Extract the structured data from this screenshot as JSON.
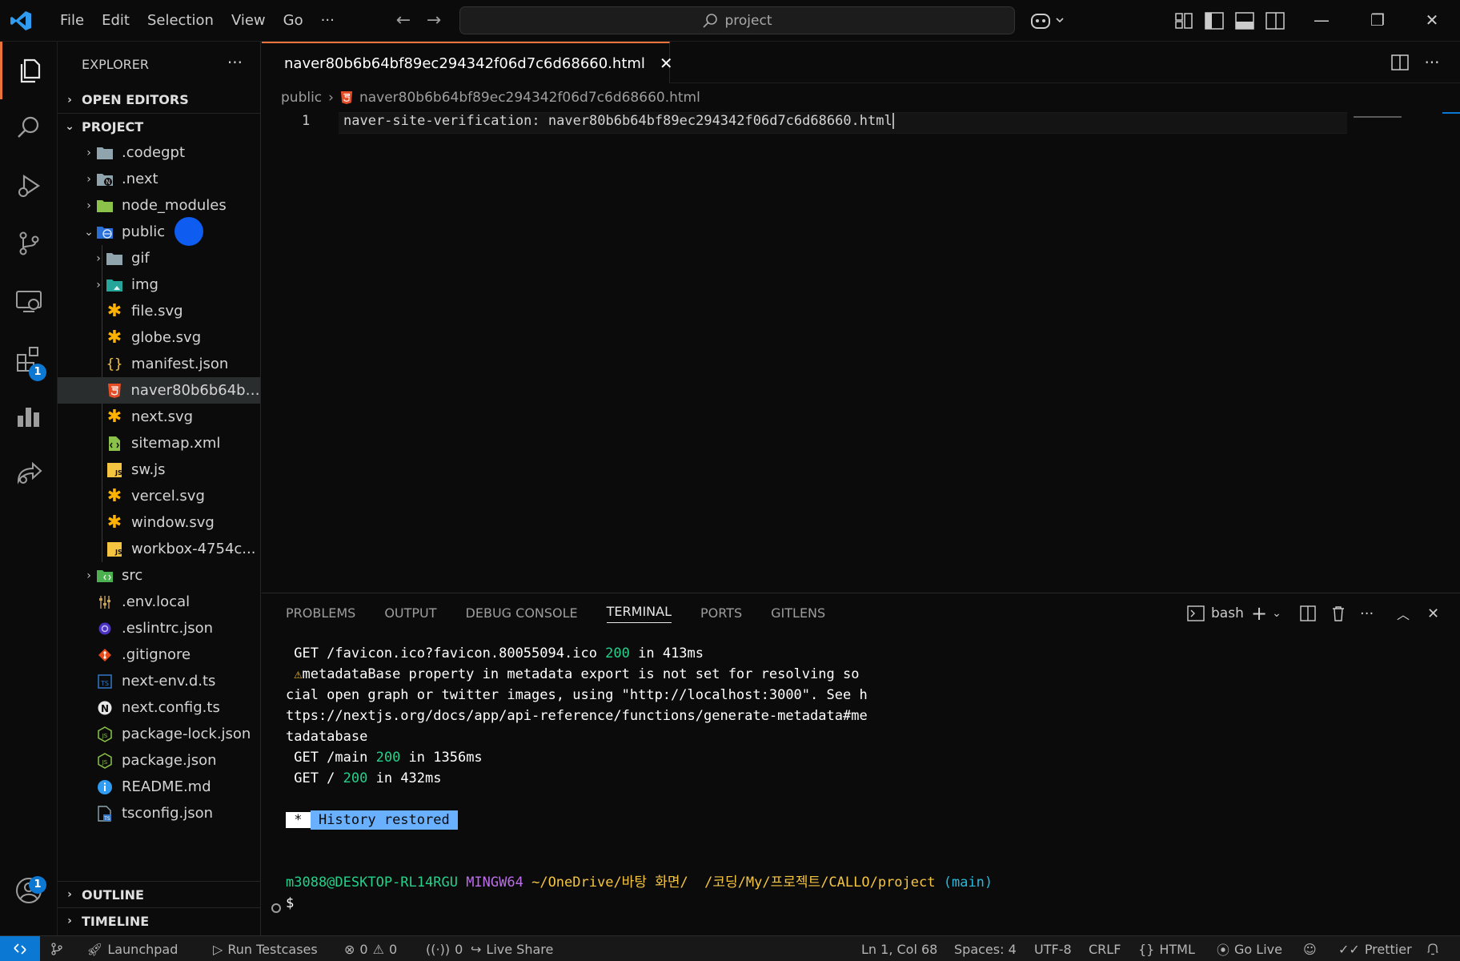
{
  "menu": [
    "File",
    "Edit",
    "Selection",
    "View",
    "Go",
    "···"
  ],
  "search": {
    "text": "project"
  },
  "window_controls": {
    "minimize": "—",
    "restore": "❐",
    "close": "✕"
  },
  "activity": {
    "extensions_badge": "1",
    "accounts_badge": "1"
  },
  "explorer": {
    "title": "EXPLORER",
    "more": "···",
    "open_editors": "OPEN EDITORS",
    "project": "PROJECT",
    "outline": "OUTLINE",
    "timeline": "TIMELINE",
    "tree": [
      {
        "label": ".codegpt",
        "chev": "›"
      },
      {
        "label": ".next",
        "chev": "›"
      },
      {
        "label": "node_modules",
        "chev": "›"
      },
      {
        "label": "public",
        "chev": "⌄"
      },
      {
        "label": "gif",
        "chev": "›"
      },
      {
        "label": "img",
        "chev": "›"
      },
      {
        "label": "file.svg"
      },
      {
        "label": "globe.svg"
      },
      {
        "label": "manifest.json"
      },
      {
        "label": "naver80b6b64bf..."
      },
      {
        "label": "next.svg"
      },
      {
        "label": "sitemap.xml"
      },
      {
        "label": "sw.js"
      },
      {
        "label": "vercel.svg"
      },
      {
        "label": "window.svg"
      },
      {
        "label": "workbox-4754c..."
      },
      {
        "label": "src",
        "chev": "›"
      },
      {
        "label": ".env.local"
      },
      {
        "label": ".eslintrc.json"
      },
      {
        "label": ".gitignore"
      },
      {
        "label": "next-env.d.ts"
      },
      {
        "label": "next.config.ts"
      },
      {
        "label": "package-lock.json"
      },
      {
        "label": "package.json"
      },
      {
        "label": "README.md"
      },
      {
        "label": "tsconfig.json"
      }
    ]
  },
  "editor": {
    "tab_label": "naver80b6b64bf89ec294342f06d7c6d68660.html",
    "tab_close": "✕",
    "breadcrumb_folder": "public",
    "breadcrumb_sep": "›",
    "breadcrumb_file": "naver80b6b64bf89ec294342f06d7c6d68660.html",
    "line_number": "1",
    "code": "naver-site-verification: naver80b6b64bf89ec294342f06d7c6d68660.html"
  },
  "panel": {
    "tabs": [
      "PROBLEMS",
      "OUTPUT",
      "DEBUG CONSOLE",
      "TERMINAL",
      "PORTS",
      "GITLENS"
    ],
    "active_tab": "TERMINAL",
    "shell": "bash",
    "terminal": {
      "l1a": " GET /favicon.ico?favicon.80055094.ico ",
      "l1b": "200",
      "l1c": " in 413ms",
      "l2a": " ⚠",
      "l2b": "metadataBase property in metadata export is not set for resolving so",
      "l3": "cial open graph or twitter images, using \"http://localhost:3000\". See h",
      "l4": "ttps://nextjs.org/docs/app/api-reference/functions/generate-metadata#me",
      "l5": "tadatabase",
      "l6a": " GET /main ",
      "l6b": "200",
      "l6c": " in 1356ms",
      "l7a": " GET / ",
      "l7b": "200",
      "l7c": " in 432ms",
      "hist_star": " * ",
      "hist_text": " History restored ",
      "prompt_user": "m3088@DESKTOP-RL14RGU",
      "prompt_env": "MINGW64",
      "prompt_path": "~/OneDrive/바탕 화면/  /코딩/My/프로젝트/CALLO/project",
      "prompt_branch": "(main)",
      "prompt_symbol": "$"
    }
  },
  "statusbar": {
    "launchpad": "Launchpad",
    "run_testcases": "Run Testcases",
    "errors": "0",
    "warnings": "0",
    "ports": "0",
    "live_share": "Live Share",
    "position": "Ln 1, Col 68",
    "spaces": "Spaces: 4",
    "encoding": "UTF-8",
    "eol": "CRLF",
    "language": "HTML",
    "go_live": "Go Live",
    "prettier": "Prettier"
  },
  "colors": {
    "accent_orange": "#e9733b",
    "accent_blue": "#0b78d4",
    "terminal_green": "#23d18b",
    "terminal_yellow": "#f5c542",
    "terminal_cyan": "#29b8db",
    "terminal_purple": "#bc6de9"
  }
}
